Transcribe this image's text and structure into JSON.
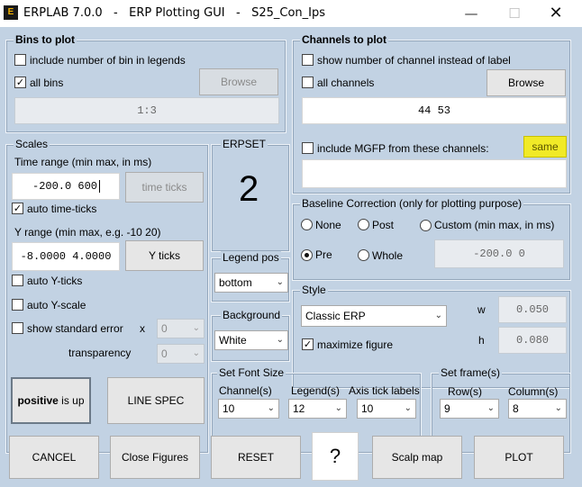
{
  "window": {
    "title": "ERPLAB 7.0.0   -   ERP Plotting GUI   -   S25_Con_Ips",
    "icon": "erplab-icon",
    "minimize": "—",
    "maximize": "☐",
    "close": "✕"
  },
  "bins": {
    "title": "Bins to plot",
    "include_number_label": "include number of bin in legends",
    "include_number_checked": false,
    "all_bins_label": "all bins",
    "all_bins_checked": true,
    "browse_label": "Browse",
    "bins_value": "1:3"
  },
  "channels": {
    "title": "Channels to plot",
    "show_number_label": "show number of channel instead of label",
    "show_number_checked": false,
    "all_channels_label": "all channels",
    "all_channels_checked": false,
    "browse_label": "Browse",
    "channels_value": "44 53",
    "mgfp_label": "include MGFP from these channels:",
    "mgfp_checked": false,
    "same_label": "same",
    "mgfp_value": ""
  },
  "scales": {
    "title": "Scales",
    "time_range_label": "Time range (min max, in ms)",
    "time_range_value": "-200.0 600",
    "time_ticks_label": "time ticks",
    "auto_time_ticks_label": "auto time-ticks",
    "auto_time_ticks_checked": true,
    "y_range_label": "Y range (min max, e.g.  -10   20)",
    "y_range_value": "-8.0000 4.0000",
    "y_ticks_label": "Y ticks",
    "auto_y_ticks_label": "auto Y-ticks",
    "auto_y_scale_label": "auto Y-scale",
    "show_std_error_label": "show standard error",
    "x_label": "x",
    "std_error_value": "0",
    "transparency_label": "transparency",
    "transparency_value": "0",
    "positive_bold": "positive",
    "positive_rest": " is up",
    "line_spec_label": "LINE SPEC"
  },
  "erpset": {
    "title": "ERPSET",
    "value": "2"
  },
  "legend_pos": {
    "title": "Legend pos",
    "value": "bottom"
  },
  "background": {
    "title": "Background",
    "value": "White"
  },
  "baseline": {
    "title": "Baseline Correction (only for plotting purpose)",
    "none_label": "None",
    "post_label": "Post",
    "custom_label": "Custom (min max, in ms)",
    "pre_label": "Pre",
    "whole_label": "Whole",
    "selected": "pre",
    "custom_value": "-200.0   0"
  },
  "style": {
    "title": "Style",
    "value": "Classic ERP",
    "w_label": "w",
    "w_value": "0.050",
    "h_label": "h",
    "h_value": "0.080",
    "maximize_label": "maximize figure",
    "maximize_checked": true
  },
  "font_size": {
    "title": "Set Font Size",
    "channel_label": "Channel(s)",
    "channel_value": "10",
    "legend_label": "Legend(s)",
    "legend_value": "12",
    "axis_label": "Axis tick labels",
    "axis_value": "10"
  },
  "frame": {
    "title": "Set frame(s)",
    "row_label": "Row(s)",
    "row_value": "9",
    "column_label": "Column(s)",
    "column_value": "8"
  },
  "footer": {
    "cancel": "CANCEL",
    "close_figures": "Close Figures",
    "reset": "RESET",
    "help": "?",
    "scalp_map": "Scalp map",
    "plot": "PLOT"
  },
  "glyphs": {
    "check": "✓",
    "chevron": "⌄"
  }
}
